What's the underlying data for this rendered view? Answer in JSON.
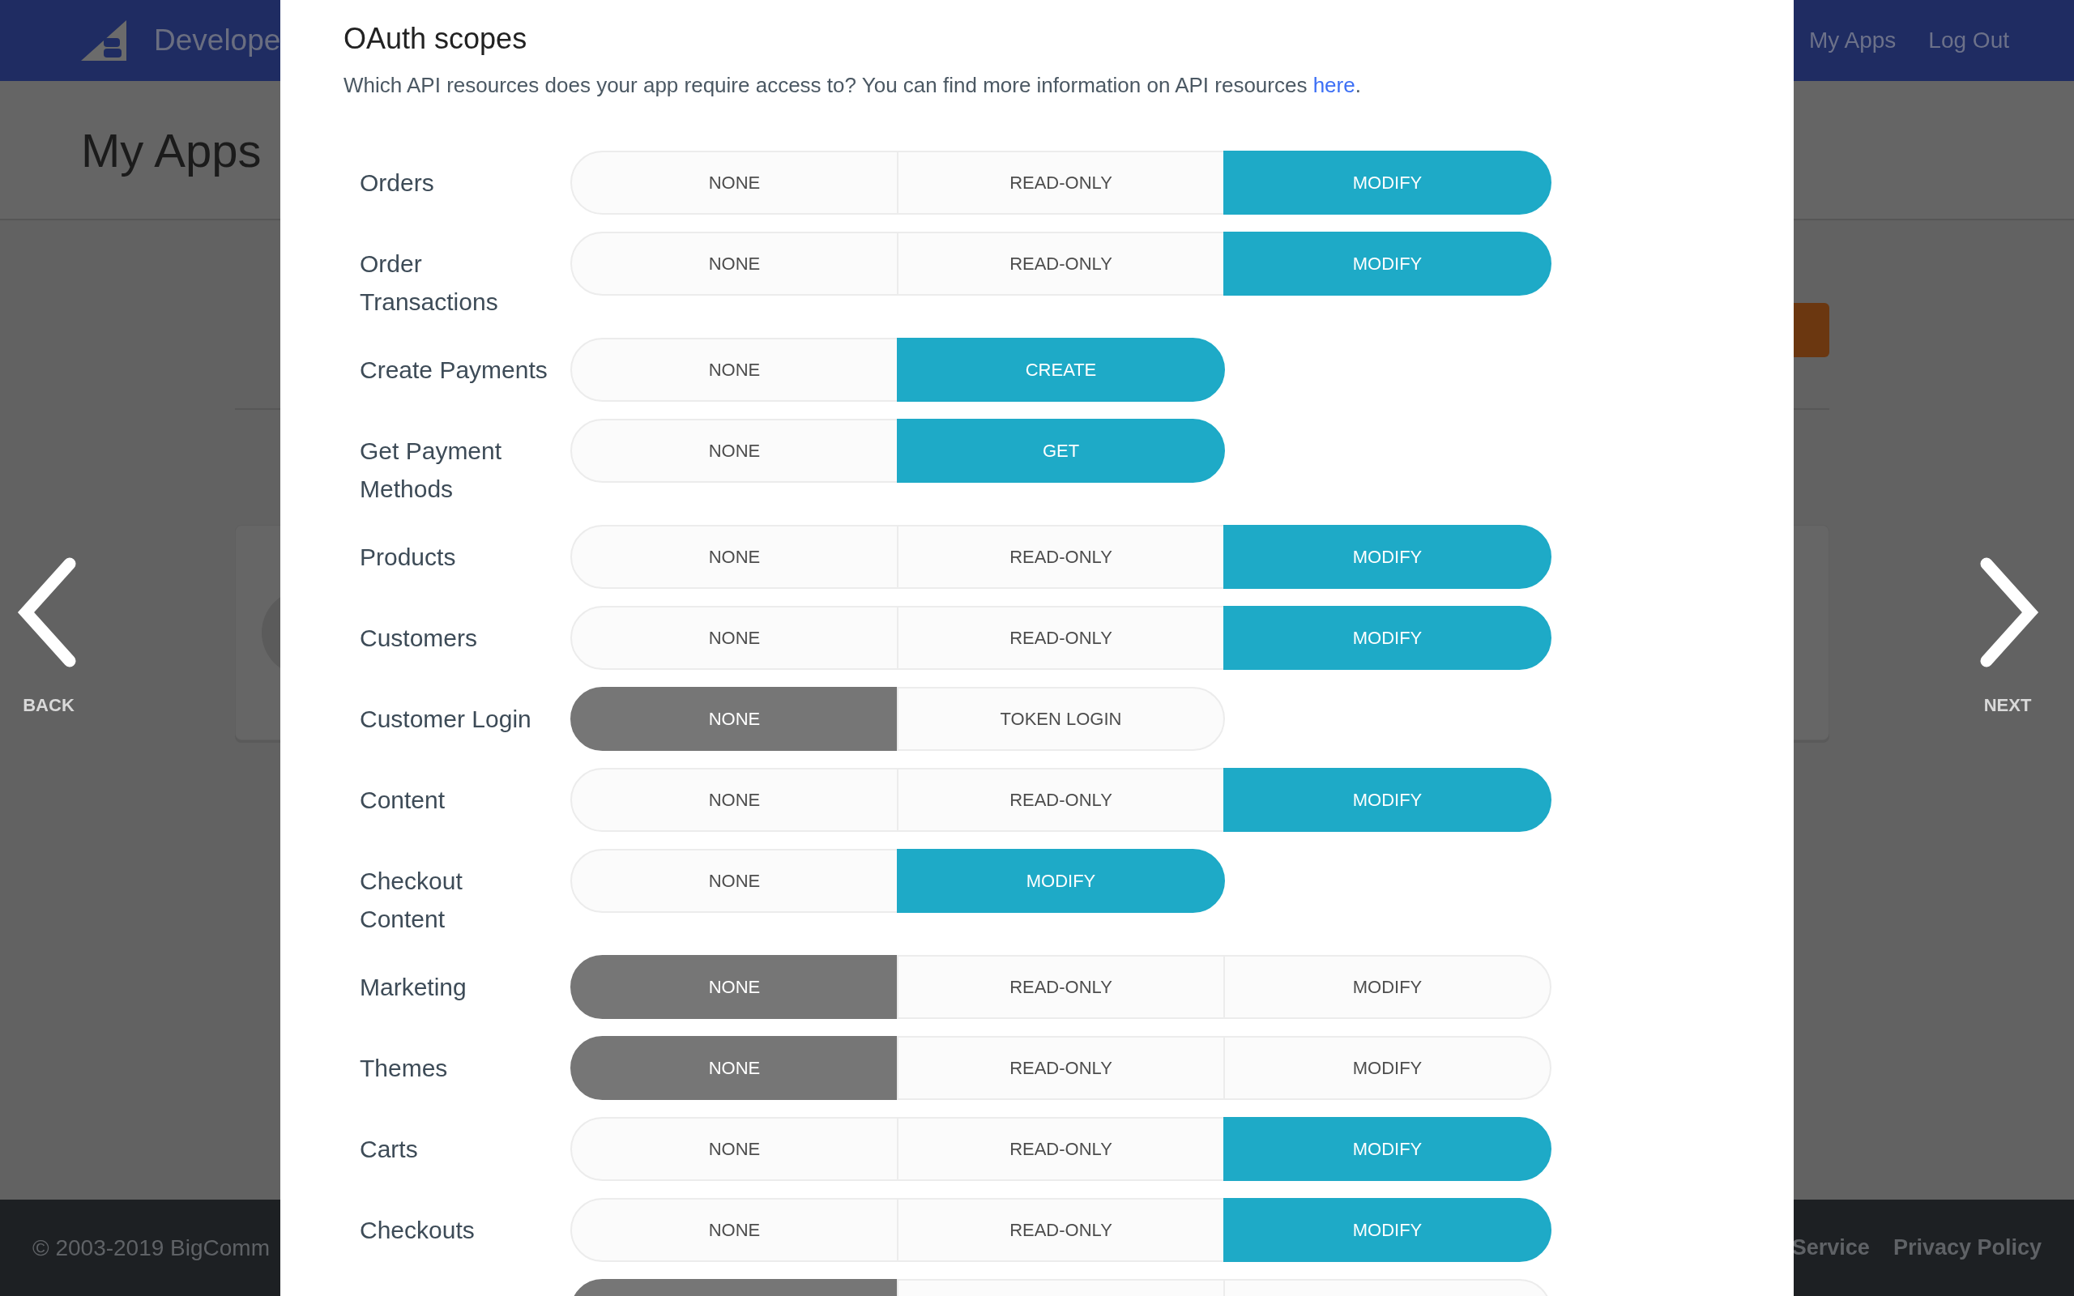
{
  "page": {
    "header": {
      "brand": "Develope",
      "nav": [
        {
          "label": "My Apps"
        },
        {
          "label": "Log Out"
        }
      ]
    },
    "title": "My Apps",
    "footer": {
      "copyright": "© 2003-2019 BigComm",
      "links": [
        {
          "label": "Service"
        },
        {
          "label": "Privacy Policy"
        }
      ]
    }
  },
  "carousel": {
    "back": "BACK",
    "next": "NEXT"
  },
  "modal": {
    "title": "OAuth scopes",
    "description": {
      "before": "Which API resources does your app require access to? You can find more information on API resources ",
      "link": "here",
      "after": "."
    },
    "scopes": [
      {
        "label": "Orders",
        "options": [
          {
            "label": "NONE",
            "selected": false
          },
          {
            "label": "READ-ONLY",
            "selected": false
          },
          {
            "label": "MODIFY",
            "selected": true
          }
        ]
      },
      {
        "label": "Order Transactions",
        "options": [
          {
            "label": "NONE",
            "selected": false
          },
          {
            "label": "READ-ONLY",
            "selected": false
          },
          {
            "label": "MODIFY",
            "selected": true
          }
        ]
      },
      {
        "label": "Create Payments",
        "options": [
          {
            "label": "NONE",
            "selected": false
          },
          {
            "label": "CREATE",
            "selected": true
          }
        ]
      },
      {
        "label": "Get Payment Methods",
        "options": [
          {
            "label": "NONE",
            "selected": false
          },
          {
            "label": "GET",
            "selected": true
          }
        ]
      },
      {
        "label": "Products",
        "options": [
          {
            "label": "NONE",
            "selected": false
          },
          {
            "label": "READ-ONLY",
            "selected": false
          },
          {
            "label": "MODIFY",
            "selected": true
          }
        ]
      },
      {
        "label": "Customers",
        "options": [
          {
            "label": "NONE",
            "selected": false
          },
          {
            "label": "READ-ONLY",
            "selected": false
          },
          {
            "label": "MODIFY",
            "selected": true
          }
        ]
      },
      {
        "label": "Customer Login",
        "options": [
          {
            "label": "NONE",
            "selected": true
          },
          {
            "label": "TOKEN LOGIN",
            "selected": false
          }
        ]
      },
      {
        "label": "Content",
        "options": [
          {
            "label": "NONE",
            "selected": false
          },
          {
            "label": "READ-ONLY",
            "selected": false
          },
          {
            "label": "MODIFY",
            "selected": true
          }
        ]
      },
      {
        "label": "Checkout Content",
        "options": [
          {
            "label": "NONE",
            "selected": false
          },
          {
            "label": "MODIFY",
            "selected": true
          }
        ]
      },
      {
        "label": "Marketing",
        "options": [
          {
            "label": "NONE",
            "selected": true
          },
          {
            "label": "READ-ONLY",
            "selected": false
          },
          {
            "label": "MODIFY",
            "selected": false
          }
        ]
      },
      {
        "label": "Themes",
        "options": [
          {
            "label": "NONE",
            "selected": true
          },
          {
            "label": "READ-ONLY",
            "selected": false
          },
          {
            "label": "MODIFY",
            "selected": false
          }
        ]
      },
      {
        "label": "Carts",
        "options": [
          {
            "label": "NONE",
            "selected": false
          },
          {
            "label": "READ-ONLY",
            "selected": false
          },
          {
            "label": "MODIFY",
            "selected": true
          }
        ]
      },
      {
        "label": "Checkouts",
        "options": [
          {
            "label": "NONE",
            "selected": false
          },
          {
            "label": "READ-ONLY",
            "selected": false
          },
          {
            "label": "MODIFY",
            "selected": true
          }
        ]
      },
      {
        "options": [
          {
            "selected": true
          },
          {
            "selected": false
          },
          {
            "selected": false
          }
        ]
      }
    ]
  }
}
